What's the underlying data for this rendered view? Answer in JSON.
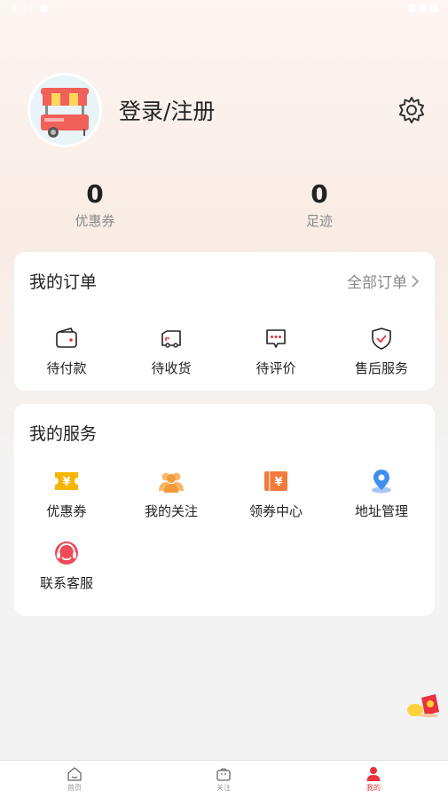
{
  "status_bar": {
    "time": "3:03"
  },
  "profile": {
    "login_label": "登录/注册"
  },
  "stats": [
    {
      "value": "0",
      "label": "优惠券"
    },
    {
      "value": "0",
      "label": "足迹"
    }
  ],
  "orders": {
    "title": "我的订单",
    "all_link": "全部订单",
    "items": [
      {
        "label": "待付款",
        "icon": "wallet-icon"
      },
      {
        "label": "待收货",
        "icon": "truck-icon"
      },
      {
        "label": "待评价",
        "icon": "comment-icon"
      },
      {
        "label": "售后服务",
        "icon": "shield-check-icon"
      }
    ]
  },
  "services": {
    "title": "我的服务",
    "items": [
      {
        "label": "优惠券",
        "icon": "coupon-icon"
      },
      {
        "label": "我的关注",
        "icon": "people-icon"
      },
      {
        "label": "领券中心",
        "icon": "ticket-center-icon"
      },
      {
        "label": "地址管理",
        "icon": "location-pin-icon"
      },
      {
        "label": "联系客服",
        "icon": "headset-icon"
      }
    ]
  },
  "tabbar": {
    "tabs": [
      {
        "label": "首页",
        "icon": "home-icon"
      },
      {
        "label": "关注",
        "icon": "bag-icon"
      },
      {
        "label": "我的",
        "icon": "user-icon",
        "active": true
      }
    ]
  },
  "colors": {
    "accent": "#e8323c",
    "coupon_yellow": "#f7b500",
    "service_orange": "#f47a3c",
    "location_blue": "#3f8ef0"
  }
}
